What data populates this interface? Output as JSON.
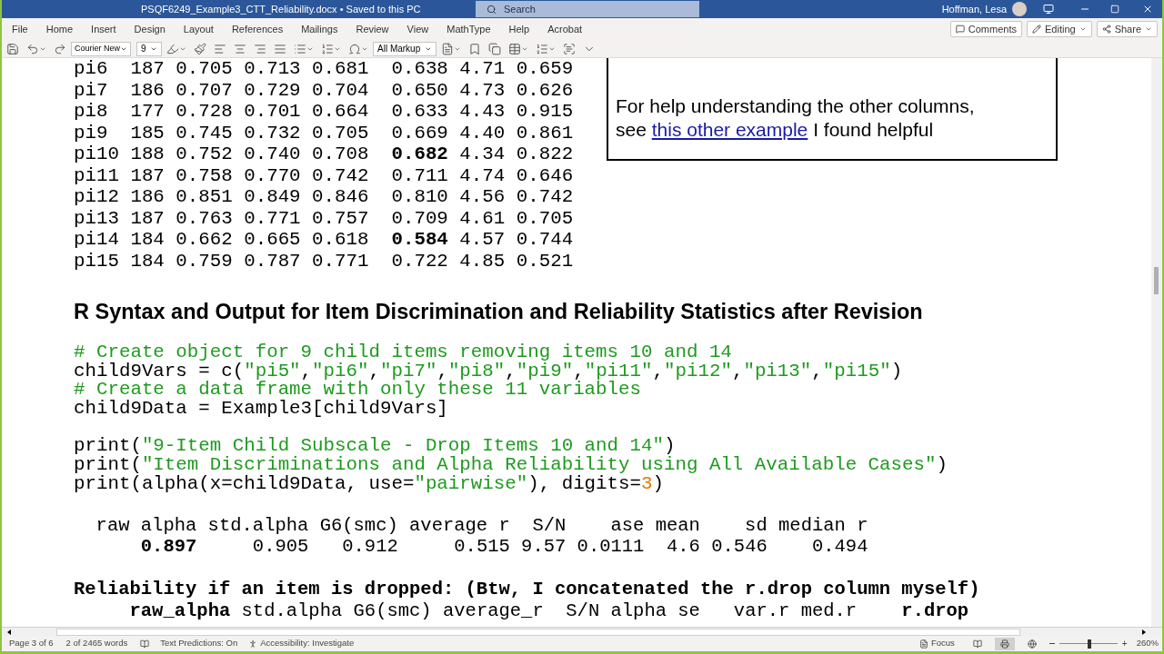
{
  "window": {
    "title": "PSQF6249_Example3_CTT_Reliability.docx • Saved to this PC",
    "search_placeholder": "Search",
    "user": "Hoffman, Lesa"
  },
  "menu": [
    "File",
    "Home",
    "Insert",
    "Design",
    "Layout",
    "References",
    "Mailings",
    "Review",
    "View",
    "MathType",
    "Help",
    "Acrobat"
  ],
  "actions": [
    "Comments",
    "Editing",
    "Share"
  ],
  "toolbar": {
    "font": "Courier New",
    "size": "9",
    "markup": "All Markup"
  },
  "table_rows": [
    "pi6  187 0.705 0.713 0.681  0.638 4.71 0.659",
    "pi7  186 0.707 0.729 0.704  0.650 4.73 0.626",
    "pi8  177 0.728 0.701 0.664  0.633 4.43 0.915",
    "pi9  185 0.745 0.732 0.705  0.669 4.40 0.861",
    "pi10 188 0.752 0.740 0.708  **0.682** 4.34 0.822",
    "pi11 187 0.758 0.770 0.742  0.711 4.74 0.646",
    "pi12 186 0.851 0.849 0.846  0.810 4.56 0.742",
    "pi13 187 0.763 0.771 0.757  0.709 4.61 0.705",
    "pi14 184 0.662 0.665 0.618  **0.584** 4.57 0.744",
    "pi15 184 0.759 0.787 0.771  0.722 4.85 0.521"
  ],
  "note": {
    "line_1": "For help understanding the other columns,",
    "line_2_before": "see",
    "link": "this other example",
    "line_2_after": "I found helpful"
  },
  "heading": "R Syntax and Output for Item Discrimination and Reliability Statistics after Revision",
  "code_lines": [
    [
      {
        "kind": "comment",
        "text": "# Create object for 9 child items removing items 10 and 14"
      }
    ],
    [
      {
        "kind": "plain",
        "text": "child9Vars = c("
      },
      {
        "kind": "string",
        "text": "\"pi5\""
      },
      {
        "kind": "plain",
        "text": ","
      },
      {
        "kind": "string",
        "text": "\"pi6\""
      },
      {
        "kind": "plain",
        "text": ","
      },
      {
        "kind": "string",
        "text": "\"pi7\""
      },
      {
        "kind": "plain",
        "text": ","
      },
      {
        "kind": "string",
        "text": "\"pi8\""
      },
      {
        "kind": "plain",
        "text": ","
      },
      {
        "kind": "string",
        "text": "\"pi9\""
      },
      {
        "kind": "plain",
        "text": ","
      },
      {
        "kind": "string",
        "text": "\"pi11\""
      },
      {
        "kind": "plain",
        "text": ","
      },
      {
        "kind": "string",
        "text": "\"pi12\""
      },
      {
        "kind": "plain",
        "text": ","
      },
      {
        "kind": "string",
        "text": "\"pi13\""
      },
      {
        "kind": "plain",
        "text": ","
      },
      {
        "kind": "string",
        "text": "\"pi15\""
      },
      {
        "kind": "plain",
        "text": ")"
      }
    ],
    [
      {
        "kind": "comment",
        "text": "# Create a data frame with only these 11 variables"
      }
    ],
    [
      {
        "kind": "plain",
        "text": "child9Data = Example3[child9Vars]"
      }
    ]
  ],
  "print_lines": [
    [
      {
        "kind": "plain",
        "text": "print("
      },
      {
        "kind": "string",
        "text": "\"9-Item Child Subscale - Drop Items 10 and 14\""
      },
      {
        "kind": "plain",
        "text": ")"
      }
    ],
    [
      {
        "kind": "plain",
        "text": "print("
      },
      {
        "kind": "string",
        "text": "\"Item Discriminations and Alpha Reliability using All Available Cases\""
      },
      {
        "kind": "plain",
        "text": ")"
      }
    ],
    [
      {
        "kind": "plain",
        "text": "print(alpha(x=child9Data, use="
      },
      {
        "kind": "string",
        "text": "\"pairwise\""
      },
      {
        "kind": "plain",
        "text": "), digits="
      },
      {
        "kind": "number",
        "text": "3"
      },
      {
        "kind": "plain",
        "text": ")"
      }
    ]
  ],
  "output_lines": [
    "  raw alpha std.alpha G6(smc) average r  S/N    ase mean    sd median r",
    "      **0.897**     0.905   0.912     0.515 9.57 0.0111  4.6 0.546    0.494"
  ],
  "dropped_lines": [
    "**Reliability if an item is dropped: (Btw, I concatenated the r.drop column myself)**",
    "     **raw_alpha** std.alpha G6(smc) average_r  S/N alpha se   var.r med.r    **r.drop**"
  ],
  "status_bar": {
    "page": "Page 3 of 6",
    "words": "2 of 2465 words",
    "predictions": "Text Predictions: On",
    "accessibility": "Accessibility: Investigate",
    "focus": "Focus",
    "zoom_in": "+",
    "zoom": "260%",
    "zoom_slider": {
      "level": 0.52
    }
  }
}
